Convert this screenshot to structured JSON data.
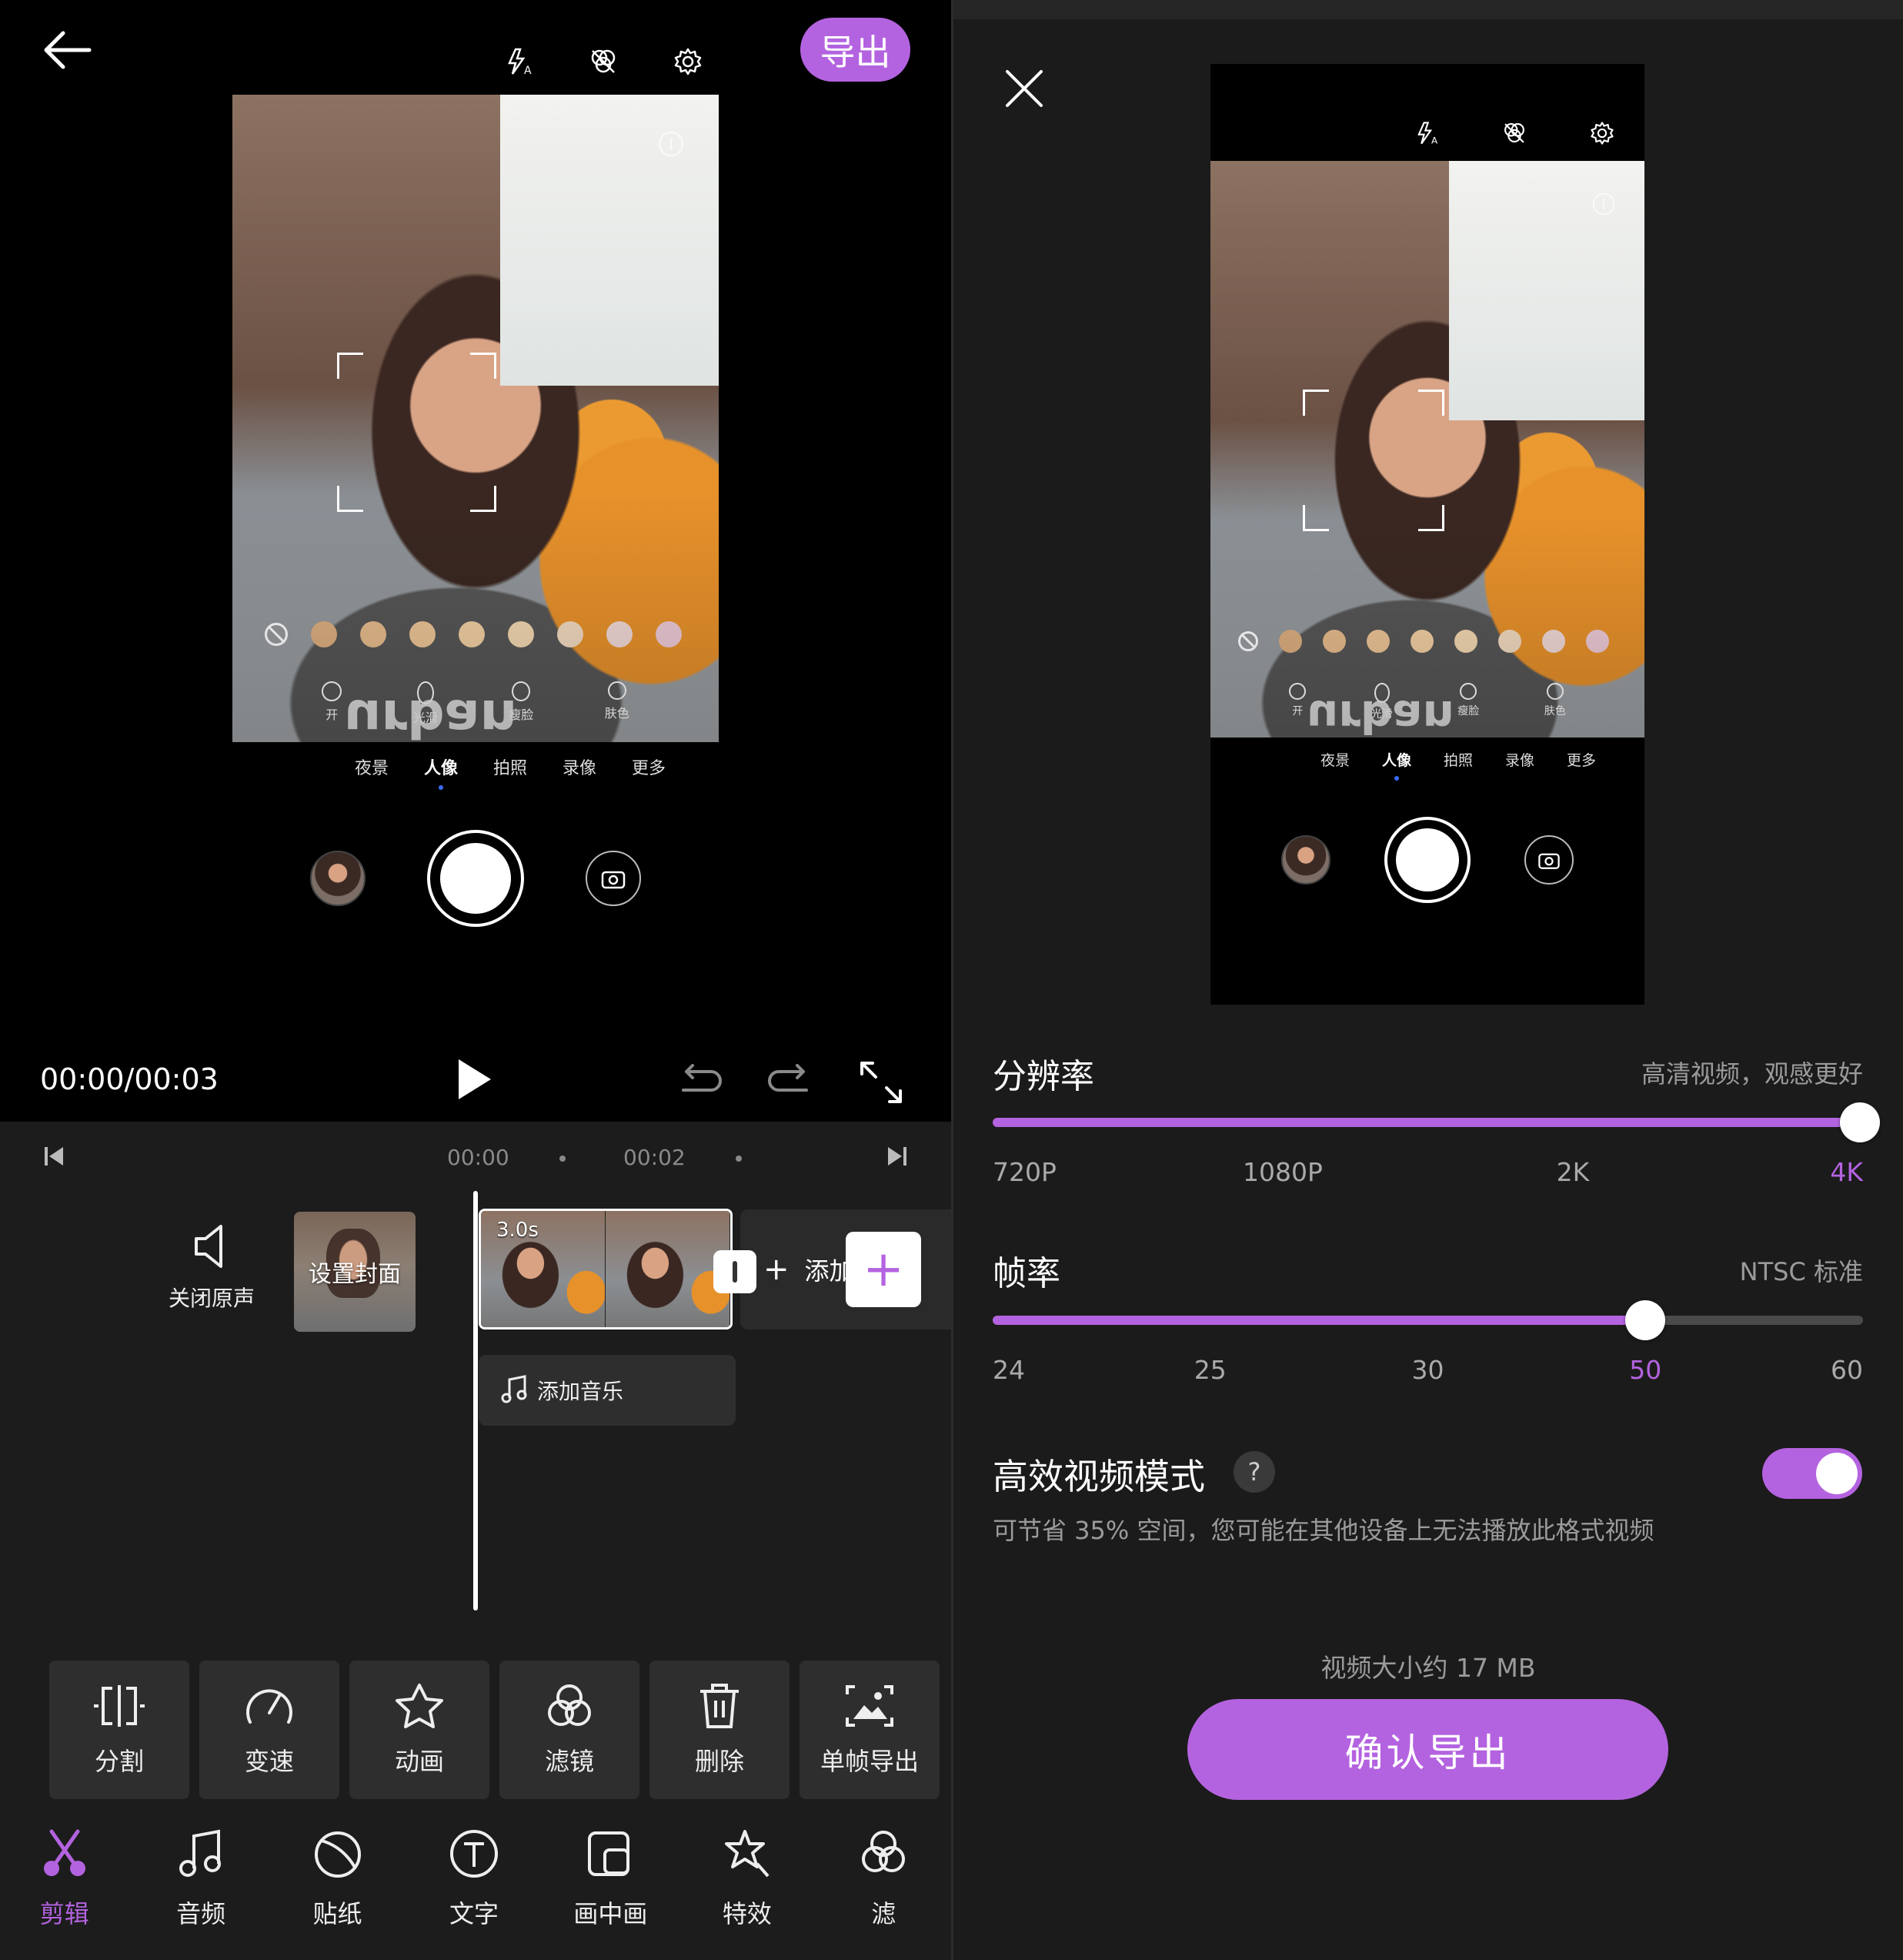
{
  "editor": {
    "export_label": "导出",
    "time_display": "00:00/00:03",
    "ruler": {
      "t0": "00:00",
      "t1": "00:02"
    },
    "mute_label": "关闭原声",
    "cover_label": "设置封面",
    "clip_duration": "3.0s",
    "add_clip_label": "添加",
    "add_music_label": "添加音乐",
    "tools": [
      {
        "label": "分割",
        "icon": "split-icon"
      },
      {
        "label": "变速",
        "icon": "speed-icon"
      },
      {
        "label": "动画",
        "icon": "animation-icon"
      },
      {
        "label": "滤镜",
        "icon": "filter-icon"
      },
      {
        "label": "删除",
        "icon": "delete-icon"
      },
      {
        "label": "单帧导出",
        "icon": "frame-export-icon"
      }
    ],
    "nav": [
      {
        "label": "剪辑",
        "icon": "scissors-icon",
        "active": true
      },
      {
        "label": "音频",
        "icon": "music-note-icon"
      },
      {
        "label": "贴纸",
        "icon": "sticker-icon"
      },
      {
        "label": "文字",
        "icon": "text-icon"
      },
      {
        "label": "画中画",
        "icon": "picture-in-picture-icon"
      },
      {
        "label": "特效",
        "icon": "effects-icon"
      },
      {
        "label": "滤",
        "icon": "filter-icon"
      }
    ]
  },
  "camera_preview": {
    "beauty": [
      "开",
      "光滑",
      "瘦脸",
      "肤色"
    ],
    "modes": [
      "夜景",
      "人像",
      "拍照",
      "录像",
      "更多"
    ],
    "active_mode": "人像",
    "watermark_text": "urban",
    "tone_colors": [
      "#dcae7f",
      "#e6bb8c",
      "#ecc496",
      "#f0cea2",
      "#f2d6b0",
      "#f1d9bf",
      "#f0d8d6",
      "#ecc9d5"
    ]
  },
  "export_settings": {
    "resolution": {
      "title": "分辨率",
      "hint": "高清视频，观感更好",
      "options": [
        "720P",
        "1080P",
        "2K",
        "4K"
      ],
      "selected": "4K",
      "level": 1.0
    },
    "frame_rate": {
      "title": "帧率",
      "hint": "NTSC 标准",
      "options": [
        "24",
        "25",
        "30",
        "50",
        "60"
      ],
      "selected": "50",
      "level": 0.75
    },
    "hevc": {
      "title": "高效视频模式",
      "help": "?",
      "enabled": true,
      "description": "可节省 35% 空间，您可能在其他设备上无法播放此格式视频"
    },
    "size_text": "视频大小约 17 MB",
    "confirm_label": "确认导出"
  },
  "colors": {
    "accent": "#b463e0",
    "panel_bg": "#1b1b1b",
    "editor_bg": "#1c1c1c"
  }
}
